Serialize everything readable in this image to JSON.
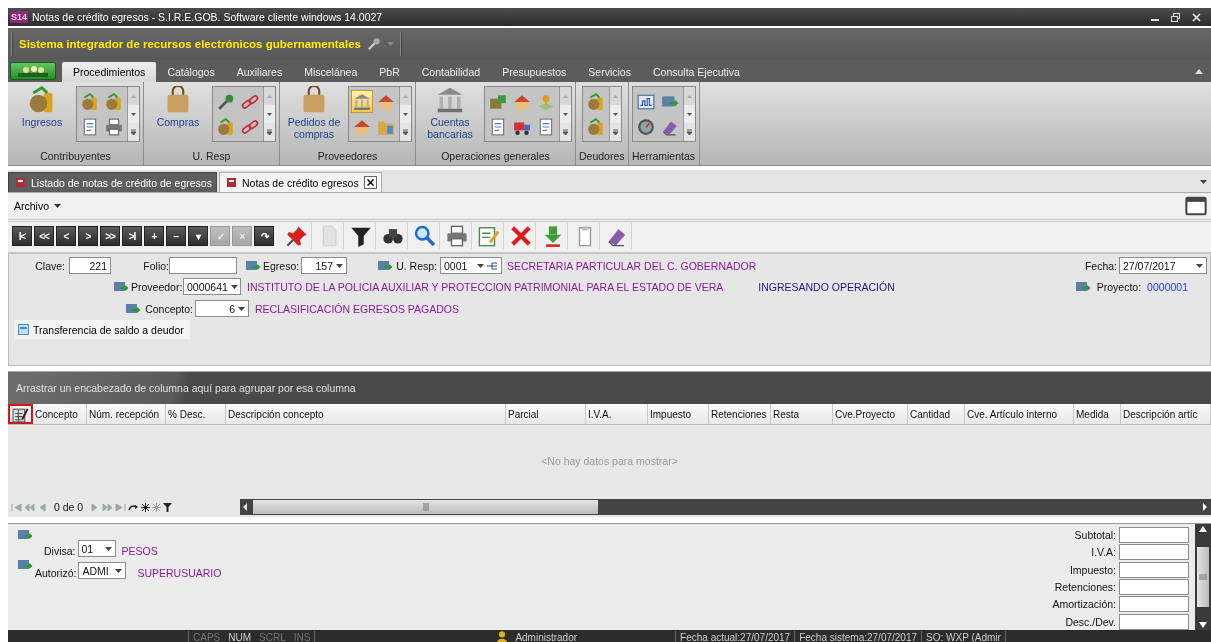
{
  "window": {
    "logo": "S14",
    "title": "Notas de crédito egresos - S.I.R.E.GOB. Software cliente windows 14.0027"
  },
  "banner": {
    "title": "Sistema integrador de recursos electrónicos gubernamentales"
  },
  "ribbon": {
    "tabs": [
      {
        "label": "Procedimientos",
        "selected": true
      },
      {
        "label": "Catálogos",
        "selected": false
      },
      {
        "label": "Auxiliares",
        "selected": false
      },
      {
        "label": "Miscelánea",
        "selected": false
      },
      {
        "label": "PbR",
        "selected": false
      },
      {
        "label": "Contabilidad",
        "selected": false
      },
      {
        "label": "Presupuestos",
        "selected": false
      },
      {
        "label": "Servicios",
        "selected": false
      },
      {
        "label": "Consulta Ejecutiva",
        "selected": false
      }
    ],
    "groups": [
      {
        "label": "Contribuyentes",
        "button": {
          "label": "Ingresos",
          "kind": "coins"
        },
        "gallery": [
          {
            "kind": "coins",
            "selected": false
          },
          {
            "kind": "document",
            "selected": false
          },
          {
            "kind": "coins",
            "selected": false
          },
          {
            "kind": "printer",
            "selected": false
          }
        ]
      },
      {
        "label": "U. Resp",
        "button": {
          "label": "Compras",
          "kind": "bag"
        },
        "gallery": [
          {
            "kind": "wrench",
            "selected": false
          },
          {
            "kind": "coins",
            "selected": false
          },
          {
            "kind": "chain",
            "selected": false
          },
          {
            "kind": "chain",
            "selected": false
          }
        ]
      },
      {
        "label": "Proveedores",
        "button": {
          "label": "Pedidos de compras",
          "kind": "bag"
        },
        "gallery": [
          {
            "kind": "bank",
            "selected": true
          },
          {
            "kind": "house",
            "selected": false
          },
          {
            "kind": "house",
            "selected": false
          },
          {
            "kind": "folder",
            "selected": false
          }
        ]
      },
      {
        "label": "Operaciones generales",
        "button": {
          "label": "Cuentas bancarias",
          "kind": "bank"
        },
        "gallery": [
          {
            "kind": "box",
            "selected": false
          },
          {
            "kind": "document",
            "selected": false
          },
          {
            "kind": "house",
            "selected": false
          },
          {
            "kind": "truck",
            "selected": false
          },
          {
            "kind": "map",
            "selected": false
          },
          {
            "kind": "document",
            "selected": false
          }
        ]
      },
      {
        "label": "Deudores",
        "gallery": [
          {
            "kind": "coins",
            "selected": false
          },
          {
            "kind": "coins",
            "selected": false
          }
        ]
      },
      {
        "label": "Herramientas",
        "gallery": [
          {
            "kind": "chart",
            "selected": false
          },
          {
            "kind": "gauge",
            "selected": false
          },
          {
            "kind": "card",
            "selected": false
          },
          {
            "kind": "eraser",
            "selected": false
          }
        ]
      }
    ]
  },
  "doc_tabs": [
    {
      "label": "Listado de notas de crédito de egresos",
      "selected": false
    },
    {
      "label": "Notas de crédito egresos",
      "selected": true
    }
  ],
  "menu": {
    "label": "Archivo"
  },
  "toolbar": [
    {
      "kind": "nav",
      "glyph": "I<",
      "disabled": false
    },
    {
      "kind": "nav",
      "glyph": "<<",
      "disabled": false
    },
    {
      "kind": "nav",
      "glyph": "<",
      "disabled": false
    },
    {
      "kind": "nav",
      "glyph": ">",
      "disabled": false
    },
    {
      "kind": "nav",
      "glyph": ">>",
      "disabled": false
    },
    {
      "kind": "nav",
      "glyph": ">I",
      "disabled": false
    },
    {
      "kind": "nav",
      "glyph": "+",
      "disabled": false
    },
    {
      "kind": "nav",
      "glyph": "−",
      "disabled": false
    },
    {
      "kind": "nav",
      "glyph": "▾",
      "disabled": false
    },
    {
      "kind": "nav",
      "glyph": "✓",
      "disabled": true
    },
    {
      "kind": "nav",
      "glyph": "×",
      "disabled": true
    },
    {
      "kind": "nav",
      "glyph": "↷",
      "disabled": false
    },
    {
      "kind": "pin",
      "disabled": false
    },
    {
      "kind": "page",
      "disabled": true
    },
    {
      "kind": "filter",
      "disabled": false
    },
    {
      "kind": "binoculars",
      "disabled": false
    },
    {
      "kind": "search",
      "disabled": false
    },
    {
      "kind": "printer",
      "disabled": false
    },
    {
      "kind": "edit",
      "disabled": false
    },
    {
      "kind": "delete",
      "disabled": false
    },
    {
      "kind": "download",
      "disabled": false
    },
    {
      "kind": "clipboard",
      "disabled": false
    },
    {
      "kind": "eraser",
      "disabled": false
    }
  ],
  "form": {
    "clave": {
      "label": "Clave:",
      "value": "221"
    },
    "folio": {
      "label": "Folio:"
    },
    "egreso": {
      "label": "Egreso:",
      "value": "157"
    },
    "u_resp": {
      "label": "U. Resp:",
      "value": "0001",
      "description": "SECRETARIA PARTICULAR DEL C. GOBERNADOR"
    },
    "fecha": {
      "label": "Fecha:",
      "value": "27/07/2017"
    },
    "proveedor": {
      "label": "Proveedor:",
      "value": "0000641",
      "description": "INSTITUTO DE LA POLICIA AUXILIAR Y PROTECCION PATRIMONIAL PARA EL ESTADO DE VERA"
    },
    "status": "INGRESANDO OPERACIÓN",
    "proyecto": {
      "label": "Proyecto:",
      "value": "0000001"
    },
    "concepto": {
      "label": "Concepto:",
      "value": "6",
      "description": "RECLASIFICACIÓN EGRESOS PAGADOS"
    },
    "transfer_button": "Transferencia de saldo a deudor"
  },
  "grid": {
    "group_hint": "Arrastrar un encabezado de columna aquí para agrupar por esa columna",
    "chooser_highlighted": true,
    "columns": [
      "Concepto",
      "Núm. recepción",
      "% Desc.",
      "Descripción concepto",
      "Parcial",
      "I.V.A.",
      "Impuesto",
      "Retenciones",
      "Resta",
      "Cve.Proyecto",
      "Cantidad",
      "Cve. Artículo interno",
      "Medida",
      "Descripción artíc"
    ],
    "empty_text": "<No hay datos para mostrar>",
    "navigator": "0 de 0"
  },
  "footer": {
    "divisa": {
      "label": "Divisa:",
      "value": "01",
      "description": "PESOS"
    },
    "autorizo": {
      "label": "Autorizó:",
      "value": "ADMI",
      "description": "SUPERUSUARIO"
    },
    "totals": [
      "Subtotal:",
      "I.V.A:",
      "Impuesto:",
      "Retenciones:",
      "Amortización:",
      "Desc./Dev."
    ]
  },
  "status_bar": {
    "keys": [
      {
        "label": "CAPS",
        "on": false
      },
      {
        "label": "NUM",
        "on": true
      },
      {
        "label": "SCRL",
        "on": false
      },
      {
        "label": "INS",
        "on": false
      }
    ],
    "user": "Administrador",
    "fecha_actual": "Fecha actual:27/07/2017",
    "fecha_sistema": "Fecha sistema:27/07/2017",
    "so": "SO: WXP (Admir"
  }
}
